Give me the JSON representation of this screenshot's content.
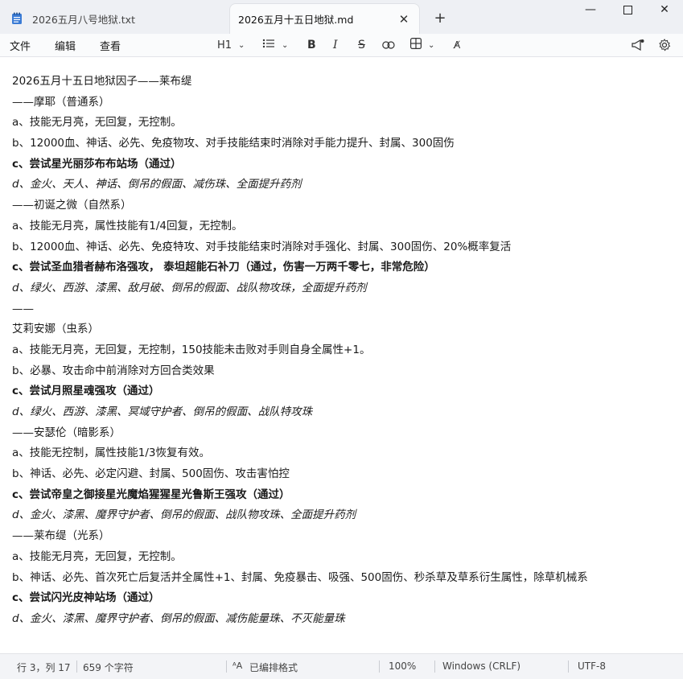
{
  "tabs": [
    {
      "label": "2026五月八号地狱.txt"
    },
    {
      "label": "2026五月十五日地狱.md"
    }
  ],
  "menu": {
    "file": "文件",
    "edit": "编辑",
    "view": "查看"
  },
  "toolbar": {
    "heading": "H1"
  },
  "content": {
    "lines": [
      {
        "text": "2026五月十五日地狱因子——莱布缇",
        "style": "normal"
      },
      {
        "text": "——摩耶（普通系）",
        "style": "normal"
      },
      {
        "text": "a、技能无月亮，无回复，无控制。",
        "style": "normal"
      },
      {
        "text": "b、12000血、神话、必先、免疫物攻、对手技能结束时消除对手能力提升、封属、300固伤",
        "style": "normal"
      },
      {
        "text": "c、尝试星光丽莎布布站场（通过）",
        "style": "bold"
      },
      {
        "text": "d、金火、天人、神话、倒吊的假面、减伤珠、全面提升药剂",
        "style": "italic"
      },
      {
        "text": "——初诞之微（自然系）",
        "style": "normal"
      },
      {
        "text": "a、技能无月亮，属性技能有1/4回复，无控制。",
        "style": "normal"
      },
      {
        "text": "b、12000血、神话、必先、免疫特攻、对手技能结束时消除对手强化、封属、300固伤、20%概率复活",
        "style": "normal"
      },
      {
        "text": "c、尝试圣血猎者赫布洛强攻， 泰坦超能石补刀（通过，伤害一万两千零七，非常危险）",
        "style": "bold"
      },
      {
        "text": "d、绿火、西游、漆黑、敌月破、倒吊的假面、战队物攻珠，全面提升药剂",
        "style": "italic"
      },
      {
        "text": "——",
        "style": "normal"
      },
      {
        "text": "艾莉安娜（虫系）",
        "style": "normal"
      },
      {
        "text": "a、技能无月亮，无回复，无控制，150技能未击败对手则自身全属性+1。",
        "style": "normal"
      },
      {
        "text": "b、必暴、攻击命中前消除对方回合类效果",
        "style": "normal"
      },
      {
        "text": "c、尝试月照星魂强攻（通过）",
        "style": "bold"
      },
      {
        "text": "d、绿火、西游、漆黑、冥域守护者、倒吊的假面、战队特攻珠",
        "style": "italic"
      },
      {
        "text": "——安瑟伦（暗影系）",
        "style": "normal"
      },
      {
        "text": "a、技能无控制，属性技能1/3恢复有效。",
        "style": "normal"
      },
      {
        "text": "b、神话、必先、必定闪避、封属、500固伤、攻击害怕控",
        "style": "normal"
      },
      {
        "text": "c、尝试帝皇之御接星光魔焰猩猩星光鲁斯王强攻（通过）",
        "style": "bold"
      },
      {
        "text": "d、金火、漆黑、魔界守护者、倒吊的假面、战队物攻珠、全面提升药剂",
        "style": "italic"
      },
      {
        "text": "——莱布缇（光系）",
        "style": "normal"
      },
      {
        "text": "a、技能无月亮，无回复，无控制。",
        "style": "normal"
      },
      {
        "text": "b、神话、必先、首次死亡后复活并全属性+1、封属、免疫暴击、吸强、500固伤、秒杀草及草系衍生属性，除草机械系",
        "style": "normal"
      },
      {
        "text": "c、尝试闪光皮神站场（通过）",
        "style": "bold"
      },
      {
        "text": "d、金火、漆黑、魔界守护者、倒吊的假面、减伤能量珠、不灭能量珠",
        "style": "italic"
      }
    ]
  },
  "status": {
    "position": "行 3，列 17",
    "chars": "659 个字符",
    "format": "已编排格式",
    "zoom": "100%",
    "line_ending": "Windows (CRLF)",
    "encoding": "UTF-8"
  },
  "icons": {
    "notepad": "notepad-icon",
    "close": "close-icon",
    "add": "plus-icon"
  }
}
